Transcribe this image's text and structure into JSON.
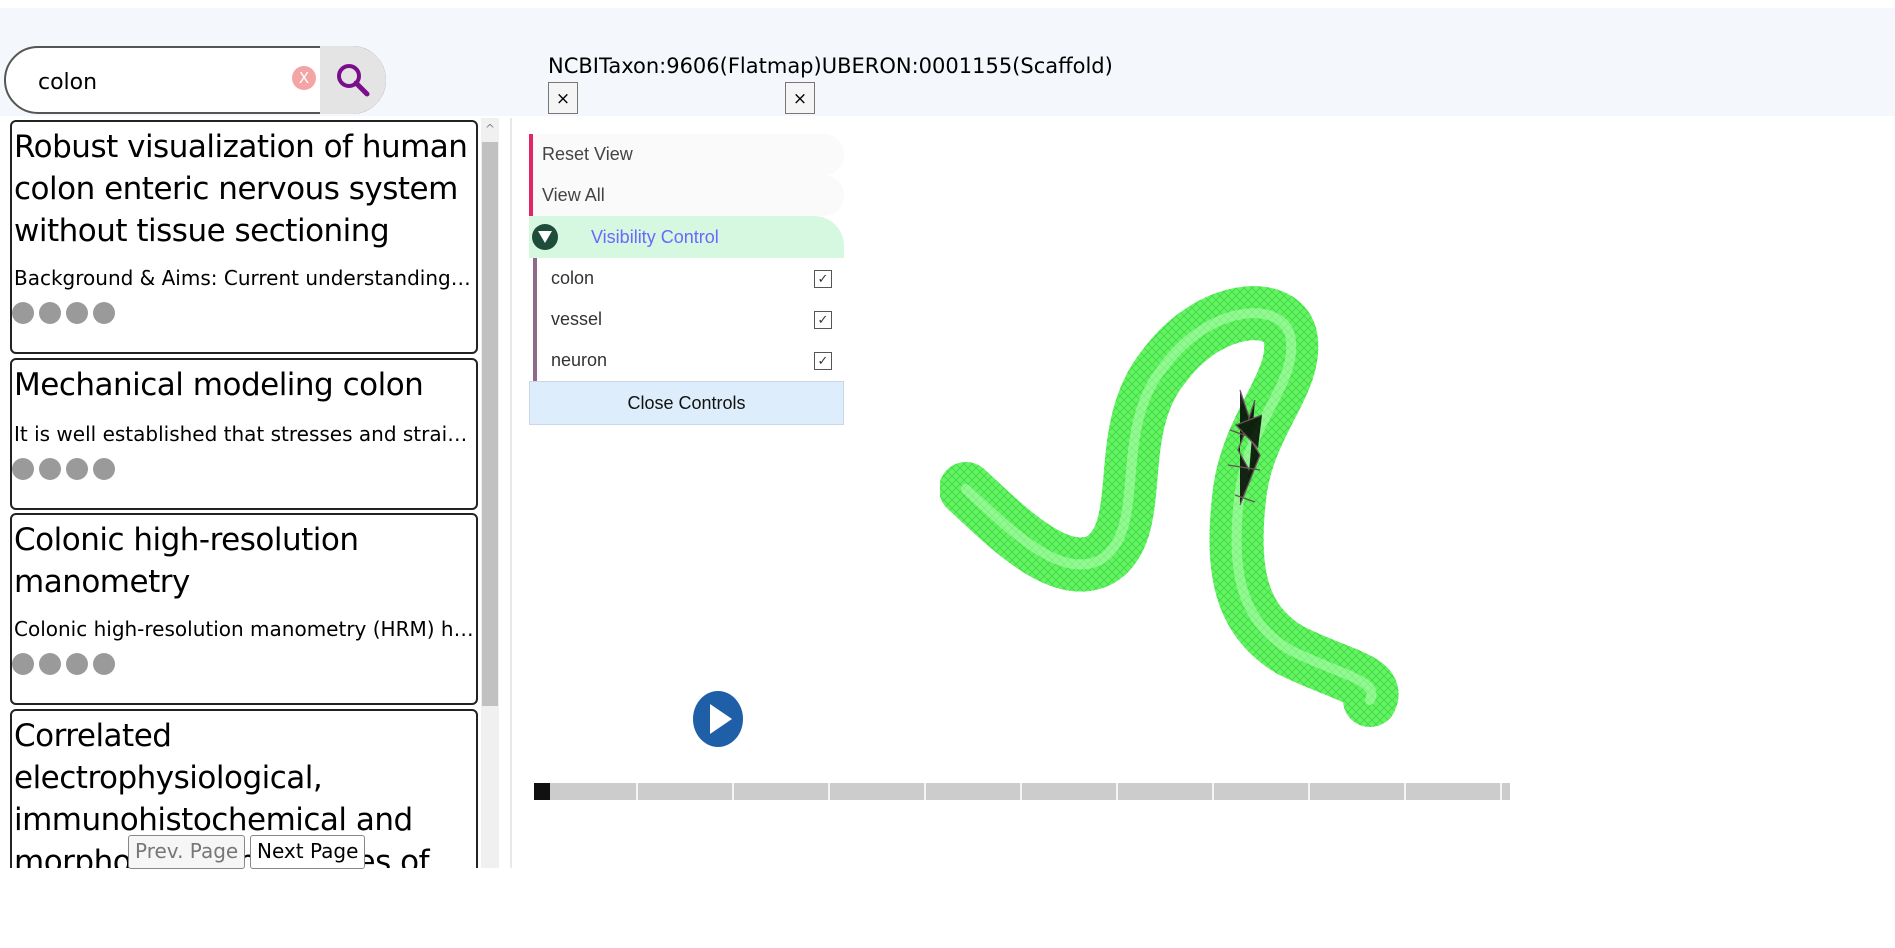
{
  "search": {
    "value": "colon",
    "clear_symbol": "X",
    "search_icon": "magnifier-icon"
  },
  "results": [
    {
      "title": "Robust visualization of human colon enteric nervous system without tissue sectioning",
      "description": "Background & Aims: Current understanding and m...",
      "dot_count": 4
    },
    {
      "title": "Mechanical modeling colon",
      "description": "It is well established that stresses and strains are...",
      "dot_count": 4
    },
    {
      "title": "Colonic high-resolution manometry",
      "description": "Colonic high-resolution manometry (HRM) has be...",
      "dot_count": 4
    },
    {
      "title": "Correlated electrophysiological, immunohistochemical and morphological properties of proxima",
      "description": "",
      "dot_count": 0
    }
  ],
  "pagination": {
    "prev_label": "Prev. Page",
    "next_label": "Next Page"
  },
  "tabs": {
    "title": "NCBITaxon:9606(Flatmap)UBERON:0001155(Scaffold)",
    "close_symbol": "×"
  },
  "controls": {
    "reset_label": "Reset View",
    "view_all_label": "View All",
    "visibility_label": "Visibility Control",
    "items": [
      {
        "label": "colon",
        "checked": true
      },
      {
        "label": "vessel",
        "checked": true
      },
      {
        "label": "neuron",
        "checked": true
      }
    ],
    "check_symbol": "✓",
    "close_label": "Close Controls"
  },
  "colors": {
    "accent_pink": "#e22566",
    "visibility_bg": "#d6f7e0",
    "visibility_text": "#6b67ff",
    "scaffold_green": "#5cf25c",
    "play_blue": "#1f5fa8"
  }
}
